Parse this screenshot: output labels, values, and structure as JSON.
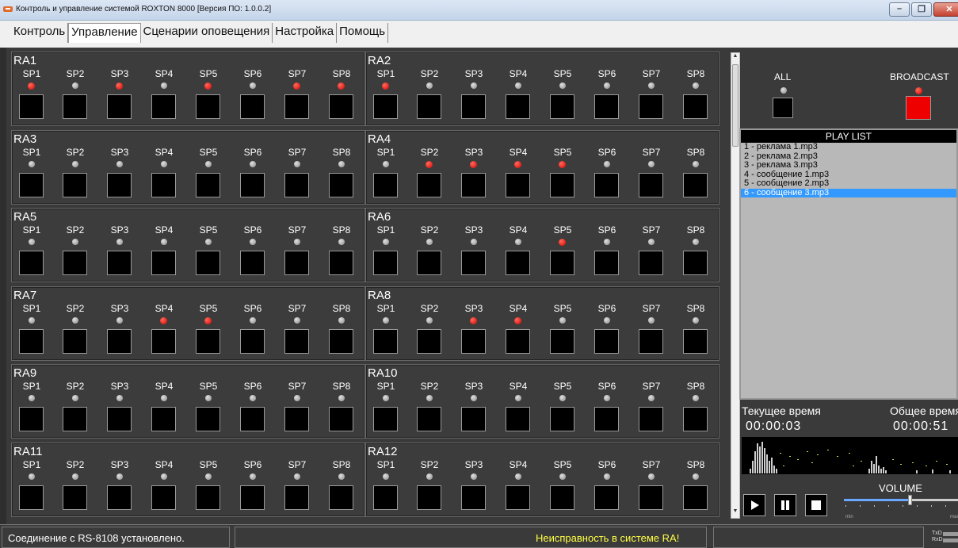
{
  "window": {
    "title": "Контроль и управление системой ROXTON 8000 [Версия ПО: 1.0.0.2]",
    "min_glyph": "–",
    "max_glyph": "❐",
    "close_glyph": "✕"
  },
  "tabs": [
    "Контроль",
    "Управление",
    "Сценарии оповещения",
    "Настройка",
    "Помощь"
  ],
  "active_tab": 1,
  "speaker_labels": [
    "SP1",
    "SP2",
    "SP3",
    "SP4",
    "SP5",
    "SP6",
    "SP7",
    "SP8"
  ],
  "zones": [
    {
      "name": "RA1",
      "active": [
        1,
        3,
        5,
        7,
        8
      ]
    },
    {
      "name": "RA2",
      "active": [
        1
      ]
    },
    {
      "name": "RA3",
      "active": []
    },
    {
      "name": "RA4",
      "active": [
        2,
        3,
        4,
        5
      ]
    },
    {
      "name": "RA5",
      "active": []
    },
    {
      "name": "RA6",
      "active": [
        5
      ]
    },
    {
      "name": "RA7",
      "active": [
        4,
        5
      ]
    },
    {
      "name": "RA8",
      "active": [
        3,
        4
      ]
    },
    {
      "name": "RA9",
      "active": []
    },
    {
      "name": "RA10",
      "active": []
    },
    {
      "name": "RA11",
      "active": []
    },
    {
      "name": "RA12",
      "active": []
    }
  ],
  "controls": {
    "all_label": "ALL",
    "all_active": false,
    "broadcast_label": "BROADCAST",
    "broadcast_active": true
  },
  "playlist": {
    "header": "PLAY LIST",
    "items": [
      "1 - реклама 1.mp3",
      "2 - реклама 2.mp3",
      "3 - реклама 3.mp3",
      "4 - сообщение 1.mp3",
      "5 - сообщение 2.mp3",
      "6 - сообщение 3.mp3"
    ],
    "selected_index": 5
  },
  "player": {
    "current_label": "Текущее время",
    "total_label": "Общее время",
    "current_time": "00:00:03",
    "total_time": "00:00:51",
    "volume_label": "VOLUME",
    "volume_level": 0.55,
    "volume_min_label": "min",
    "volume_max_label": "max",
    "play_glyph": "▶",
    "pause_glyph": "❚❚",
    "stop_glyph": "■"
  },
  "status": {
    "connection": "Соединение с RS-8108 установлено.",
    "warning": "Неисправность в системе RA!",
    "txd": "TxD",
    "rxd": "RxD"
  },
  "colors": {
    "led_active": "#d40000",
    "broadcast_button": "#ee0000",
    "warning_text": "#ffff44",
    "selection": "#3399ff"
  }
}
